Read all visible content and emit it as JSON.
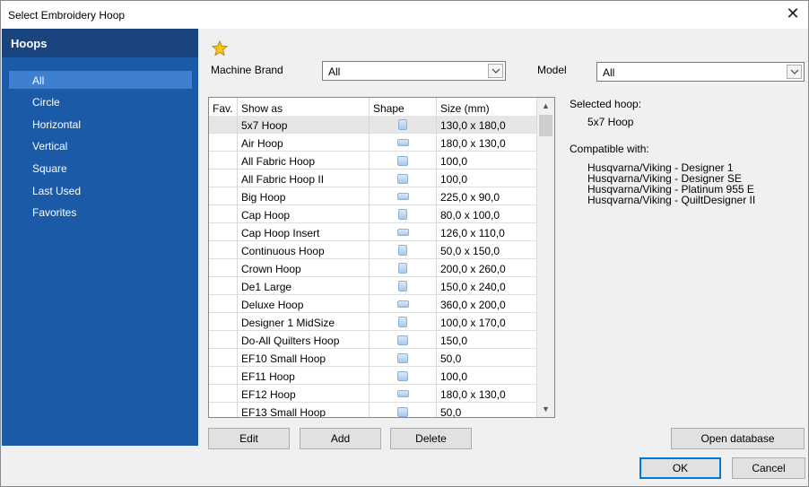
{
  "window": {
    "title": "Select Embroidery Hoop",
    "close_glyph": "✕"
  },
  "sidebar": {
    "header": "Hoops",
    "items": [
      {
        "label": "All",
        "active": true
      },
      {
        "label": "Circle"
      },
      {
        "label": "Horizontal"
      },
      {
        "label": "Vertical"
      },
      {
        "label": "Square"
      },
      {
        "label": "Last Used"
      },
      {
        "label": "Favorites"
      }
    ]
  },
  "filters": {
    "brand_label": "Machine Brand",
    "brand_value": "All",
    "model_label": "Model",
    "model_value": "All"
  },
  "table": {
    "columns": [
      "Fav.",
      "Show as",
      "Shape",
      "Size (mm)"
    ],
    "rows": [
      {
        "name": "5x7 Hoop",
        "shape": "vertical",
        "size": "130,0 x 180,0"
      },
      {
        "name": "Air Hoop",
        "shape": "horizontal",
        "size": "180,0 x 130,0"
      },
      {
        "name": "All Fabric Hoop",
        "shape": "square",
        "size": "100,0"
      },
      {
        "name": "All Fabric Hoop II",
        "shape": "square",
        "size": "100,0"
      },
      {
        "name": "Big Hoop",
        "shape": "horizontal",
        "size": "225,0 x 90,0"
      },
      {
        "name": "Cap Hoop",
        "shape": "vertical",
        "size": "80,0 x 100,0"
      },
      {
        "name": "Cap Hoop Insert",
        "shape": "horizontal",
        "size": "126,0 x 110,0"
      },
      {
        "name": "Continuous Hoop",
        "shape": "vertical",
        "size": "50,0 x 150,0"
      },
      {
        "name": "Crown Hoop",
        "shape": "vertical",
        "size": "200,0 x 260,0"
      },
      {
        "name": "De1 Large",
        "shape": "vertical",
        "size": "150,0 x 240,0"
      },
      {
        "name": "Deluxe Hoop",
        "shape": "horizontal",
        "size": "360,0 x 200,0"
      },
      {
        "name": "Designer 1 MidSize",
        "shape": "vertical",
        "size": "100,0 x 170,0"
      },
      {
        "name": "Do-All Quilters Hoop",
        "shape": "square",
        "size": "150,0"
      },
      {
        "name": "EF10 Small Hoop",
        "shape": "square",
        "size": "50,0"
      },
      {
        "name": "EF11 Hoop",
        "shape": "square",
        "size": "100,0"
      },
      {
        "name": "EF12 Hoop",
        "shape": "horizontal",
        "size": "180,0 x 130,0"
      },
      {
        "name": "EF13 Small Hoop",
        "shape": "square",
        "size": "50,0"
      }
    ]
  },
  "details": {
    "selected_label": "Selected hoop:",
    "selected_value": "5x7 Hoop",
    "compatible_label": "Compatible with:",
    "compatible": [
      "Husqvarna/Viking - Designer 1",
      "Husqvarna/Viking - Designer SE",
      "Husqvarna/Viking - Platinum 955 E",
      "Husqvarna/Viking - QuiltDesigner II"
    ]
  },
  "buttons": {
    "edit": "Edit",
    "add": "Add",
    "delete": "Delete",
    "open_database": "Open database",
    "ok": "OK",
    "cancel": "Cancel"
  },
  "colors": {
    "sidebar": "#1b5aa6",
    "sidebar_header": "#1a447e",
    "sidebar_active": "#3e7fcf",
    "star": "#f5c518"
  },
  "icons": [
    "star-icon",
    "chevron-down-icon",
    "close-icon",
    "hoop-shape-icon"
  ]
}
